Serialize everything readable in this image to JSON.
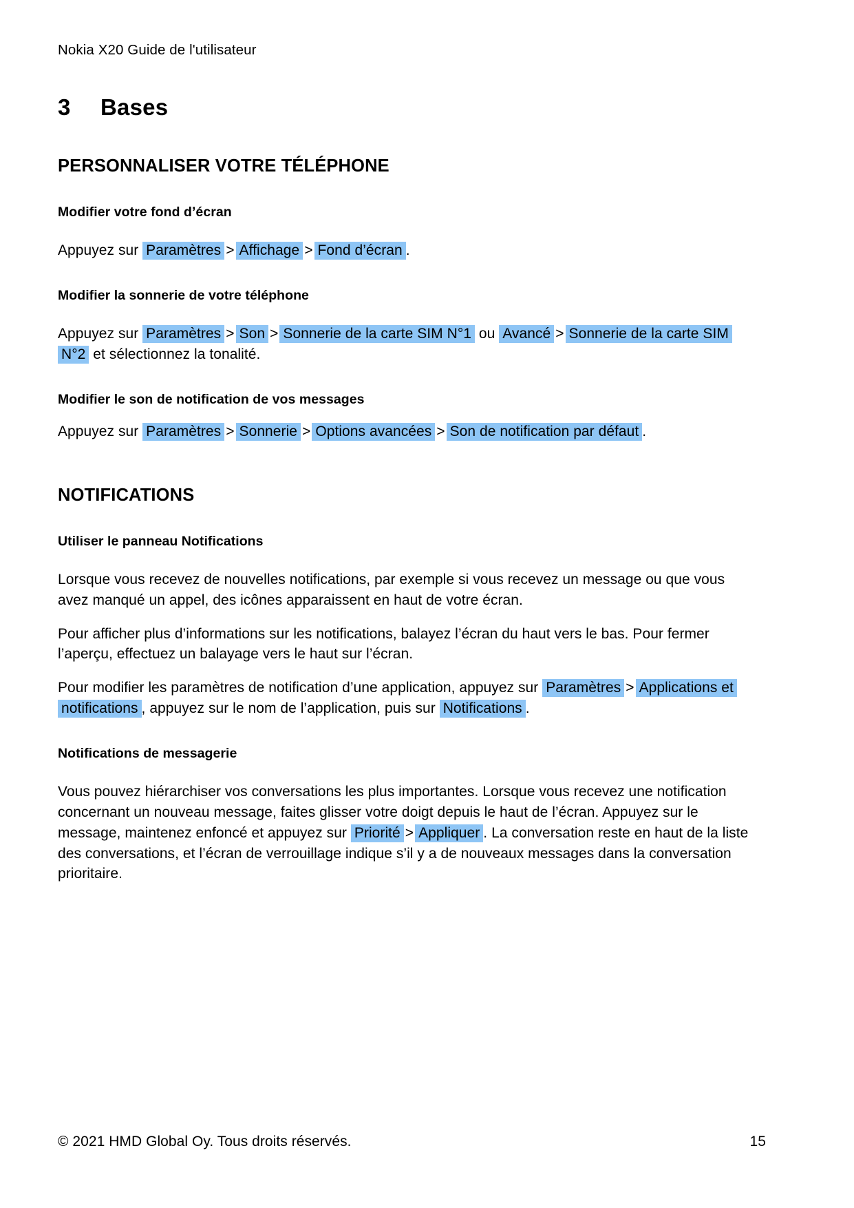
{
  "document": {
    "running_header": "Nokia X20 Guide de l'utilisateur",
    "chapter_number": "3",
    "chapter_title": "Bases",
    "highlight_color": "#8ec5f5"
  },
  "sections": [
    {
      "heading": "PERSONNALISER VOTRE TÉLÉPHONE",
      "blocks": [
        {
          "subheading": "Modifier votre fond d’écran",
          "instruction": {
            "lead": "Appuyez sur",
            "chips": [
              "Paramètres",
              "Affichage",
              "Fond d’écran"
            ],
            "separator": ">",
            "trailing": "."
          }
        },
        {
          "subheading": "Modifier la sonnerie de votre téléphone",
          "instruction": {
            "lead": "Appuyez sur",
            "chip1": "Paramètres",
            "chip2": "Son",
            "chip3": "Sonnerie de la carte SIM N°1",
            "conjunction": "ou",
            "chip4": "Avancé",
            "chip5": "Sonnerie de la carte SIM N°2",
            "separator": ">",
            "trailing": "et sélectionnez la tonalité."
          }
        },
        {
          "subheading": "Modifier le son de notification de vos messages",
          "instruction": {
            "lead": "Appuyez sur",
            "chips": [
              "Paramètres",
              "Sonnerie",
              "Options avancées",
              "Son de notification par défaut"
            ],
            "separator": ">",
            "trailing": "."
          }
        }
      ]
    },
    {
      "heading": "NOTIFICATIONS",
      "blocks": [
        {
          "subheading": "Utiliser le panneau Notifications",
          "paragraph1": "Lorsque vous recevez de nouvelles notifications, par exemple si vous recevez un message ou que vous avez manqué un appel, des icônes apparaissent en haut de votre écran.",
          "paragraph2": "Pour afficher plus d’informations sur les notifications, balayez l’écran du haut vers le bas. Pour fermer l’aperçu, effectuez un balayage vers le haut sur l’écran.",
          "paragraph3": {
            "part1": "Pour modifier les paramètres de notification d’une application, appuyez sur",
            "chip1": "Paramètres",
            "separator": ">",
            "chip2": "Applications et notifications",
            "part2": ", appuyez sur le nom de l’application, puis sur",
            "chip3": "Notifications",
            "part3": "."
          }
        },
        {
          "subheading": "Notifications de messagerie",
          "paragraph": {
            "part1": "Vous pouvez hiérarchiser vos conversations les plus importantes. Lorsque vous recevez une notification concernant un nouveau message, faites glisser votre doigt depuis le haut de l’écran. Appuyez sur le message, maintenez enfoncé et appuyez sur",
            "chip1": "Priorité",
            "separator": ">",
            "chip2": "Appliquer",
            "part2": ". La conversation reste en haut de la liste des conversations, et l’écran de verrouillage indique s’il y a de nouveaux messages dans la conversation prioritaire."
          }
        }
      ]
    }
  ],
  "footer": {
    "copyright": "© 2021 HMD Global Oy. Tous droits réservés.",
    "page_number": "15"
  }
}
